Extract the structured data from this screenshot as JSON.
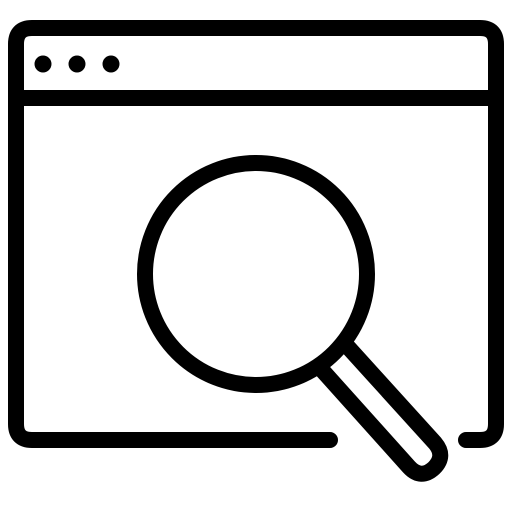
{
  "icon": {
    "name": "browser-search-icon",
    "stroke_color": "#000000",
    "background_color": "#ffffff",
    "parts": {
      "window": "browser-window-frame",
      "title_bar": "title-bar",
      "dots": [
        "window-dot",
        "window-dot",
        "window-dot"
      ],
      "magnifier": "magnifying-glass-icon"
    }
  }
}
